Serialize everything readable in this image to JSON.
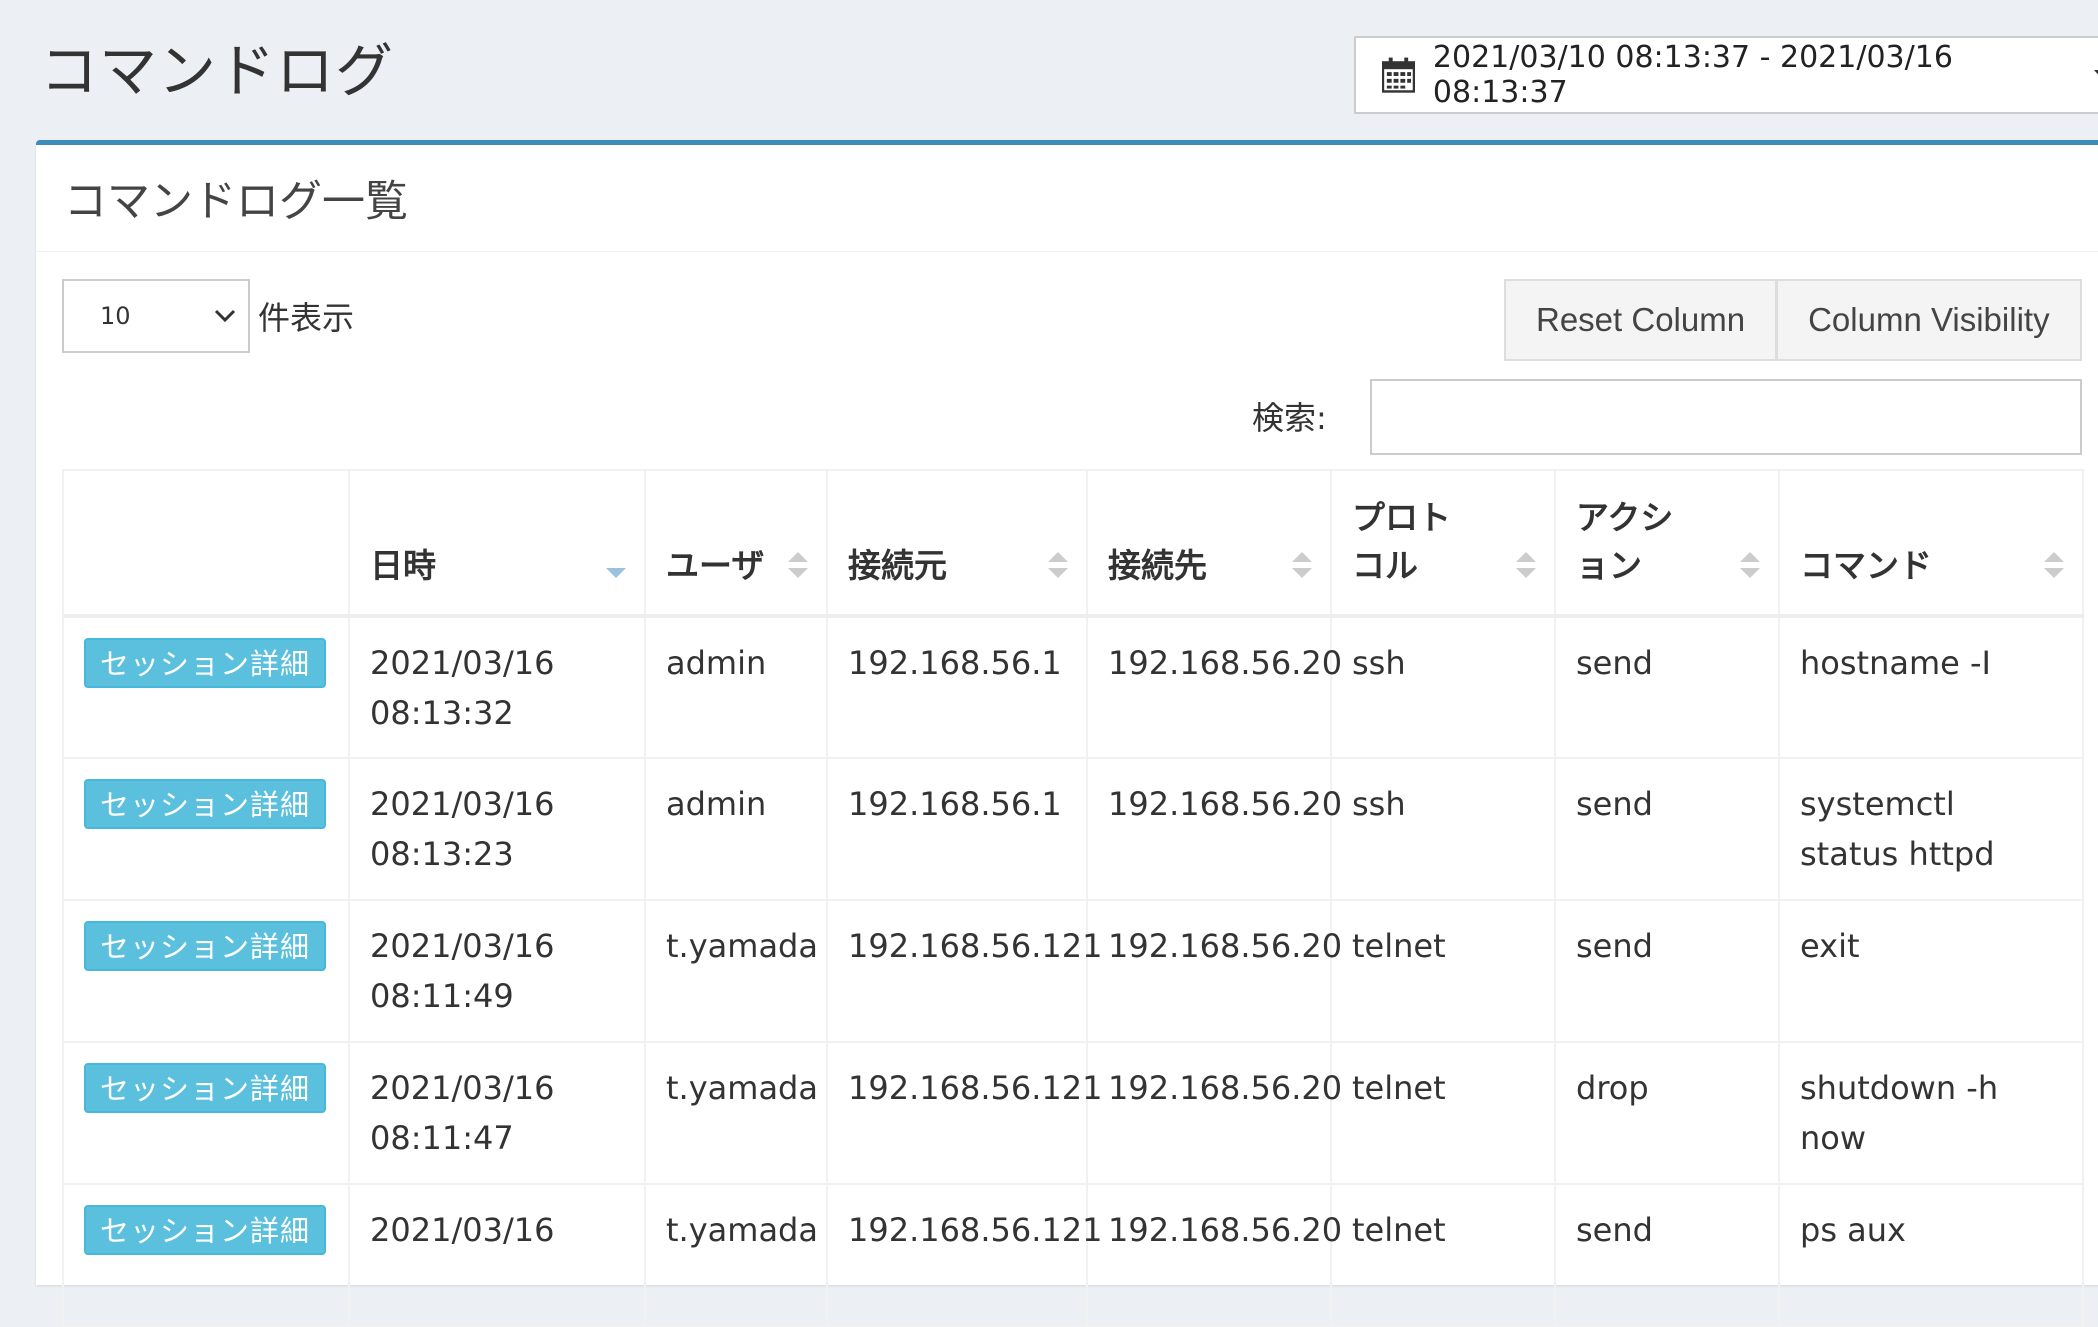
{
  "page": {
    "title": "コマンドログ",
    "date_range": "2021/03/10 08:13:37 - 2021/03/16 08:13:37"
  },
  "box": {
    "title": "コマンドログ一覧"
  },
  "controls": {
    "length_value": "10",
    "length_suffix": "件表示",
    "reset_column": "Reset Column",
    "column_visibility": "Column Visibility",
    "search_label": "検索:",
    "search_value": ""
  },
  "table": {
    "headers": [
      "",
      "日時",
      "ユーザ",
      "接続元",
      "接続先",
      "プロトコル",
      "アクション",
      "コマンド"
    ],
    "sorted_column": "日時",
    "rows": [
      {
        "button": "セッション詳細",
        "date": "2021/03/16",
        "time": "08:13:32",
        "user": "admin",
        "src": "192.168.56.1",
        "dst": "192.168.56.20",
        "protocol": "ssh",
        "action": "send",
        "command": "hostname -I"
      },
      {
        "button": "セッション詳細",
        "date": "2021/03/16",
        "time": "08:13:23",
        "user": "admin",
        "src": "192.168.56.1",
        "dst": "192.168.56.20",
        "protocol": "ssh",
        "action": "send",
        "command": "systemctl status httpd"
      },
      {
        "button": "セッション詳細",
        "date": "2021/03/16",
        "time": "08:11:49",
        "user": "t.yamada",
        "src": "192.168.56.121",
        "dst": "192.168.56.20",
        "protocol": "telnet",
        "action": "send",
        "command": "exit"
      },
      {
        "button": "セッション詳細",
        "date": "2021/03/16",
        "time": "08:11:47",
        "user": "t.yamada",
        "src": "192.168.56.121",
        "dst": "192.168.56.20",
        "protocol": "telnet",
        "action": "drop",
        "command": "shutdown -h now"
      },
      {
        "button": "セッション詳細",
        "date": "2021/03/16",
        "time": "",
        "user": "t.yamada",
        "src": "192.168.56.121",
        "dst": "192.168.56.20",
        "protocol": "telnet",
        "action": "send",
        "command": "ps aux"
      }
    ]
  },
  "colors": {
    "accent": "#3c8dbc",
    "info_button": "#5bc0de",
    "background": "#ecf0f5"
  }
}
